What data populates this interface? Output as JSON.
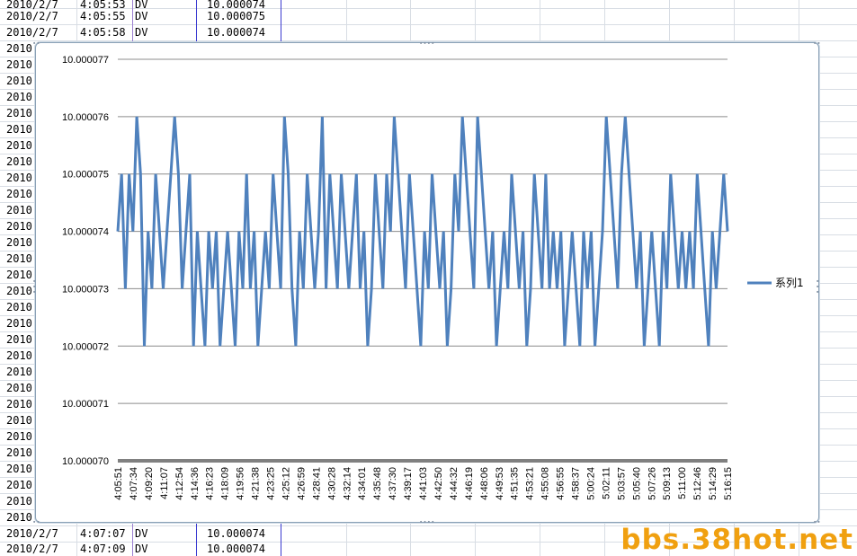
{
  "sheet": {
    "top_rows": [
      {
        "date": "2010/2/7",
        "time": "4:05:53",
        "type": "DV",
        "value": "10.000074"
      },
      {
        "date": "2010/2/7",
        "time": "4:05:55",
        "type": "DV",
        "value": "10.000075"
      },
      {
        "date": "2010/2/7",
        "time": "4:05:58",
        "type": "DV",
        "value": "10.000074"
      }
    ],
    "partial_row_label": "2010",
    "bottom_rows": [
      {
        "date": "2010/2/7",
        "time": "4:07:07",
        "type": "DV",
        "value": "10.000074"
      },
      {
        "date": "2010/2/7",
        "time": "4:07:09",
        "type": "DV",
        "value": "10.000074"
      }
    ]
  },
  "watermark": "bbs.38hot.net",
  "chart_data": {
    "type": "line",
    "title": "",
    "xlabel": "",
    "ylabel": "",
    "ylim": [
      10.00007,
      10.000077
    ],
    "yticks": [
      "10.000077",
      "10.000076",
      "10.000075",
      "10.000074",
      "10.000073",
      "10.000072",
      "10.000071",
      "10.000070"
    ],
    "categories": [
      "4:05:51",
      "4:07:34",
      "4:09:20",
      "4:11:07",
      "4:12:54",
      "4:14:36",
      "4:16:23",
      "4:18:09",
      "4:19:56",
      "4:21:38",
      "4:23:25",
      "4:25:12",
      "4:26:59",
      "4:28:41",
      "4:30:28",
      "4:32:14",
      "4:34:01",
      "4:35:48",
      "4:37:30",
      "4:39:17",
      "4:41:03",
      "4:42:50",
      "4:44:32",
      "4:46:19",
      "4:48:06",
      "4:49:53",
      "4:51:35",
      "4:53:21",
      "4:55:08",
      "4:56:55",
      "4:58:37",
      "5:00:24",
      "5:02:11",
      "5:03:57",
      "5:05:40",
      "5:07:26",
      "5:09:13",
      "5:11:00",
      "5:12:46",
      "5:14:29",
      "5:16:15"
    ],
    "grid": true,
    "legend": "right",
    "series": [
      {
        "name": "系列1",
        "color": "#4f81bd",
        "values": [
          10.000074,
          10.000075,
          10.000073,
          10.000075,
          10.000074,
          10.000076,
          10.000075,
          10.000072,
          10.000074,
          10.000073,
          10.000075,
          10.000074,
          10.000073,
          10.000074,
          10.000075,
          10.000076,
          10.000075,
          10.000073,
          10.000074,
          10.000075,
          10.000072,
          10.000074,
          10.000073,
          10.000072,
          10.000074,
          10.000073,
          10.000074,
          10.000072,
          10.000073,
          10.000074,
          10.000073,
          10.000072,
          10.000074,
          10.000073,
          10.000075,
          10.000073,
          10.000074,
          10.000072,
          10.000073,
          10.000074,
          10.000073,
          10.000075,
          10.000074,
          10.000073,
          10.000076,
          10.000075,
          10.000073,
          10.000072,
          10.000074,
          10.000073,
          10.000075,
          10.000074,
          10.000073,
          10.000074,
          10.000076,
          10.000073,
          10.000075,
          10.000074,
          10.000073,
          10.000075,
          10.000074,
          10.000073,
          10.000074,
          10.000075,
          10.000073,
          10.000074,
          10.000072,
          10.000073,
          10.000075,
          10.000074,
          10.000073,
          10.000075,
          10.000074,
          10.000076,
          10.000075,
          10.000074,
          10.000073,
          10.000075,
          10.000074,
          10.000073,
          10.000072,
          10.000074,
          10.000073,
          10.000075,
          10.000074,
          10.000073,
          10.000074,
          10.000072,
          10.000073,
          10.000075,
          10.000074,
          10.000076,
          10.000075,
          10.000074,
          10.000073,
          10.000076,
          10.000075,
          10.000074,
          10.000073,
          10.000074,
          10.000072,
          10.000073,
          10.000074,
          10.000073,
          10.000075,
          10.000074,
          10.000073,
          10.000074,
          10.000072,
          10.000073,
          10.000075,
          10.000074,
          10.000073,
          10.000075,
          10.000073,
          10.000074,
          10.000073,
          10.000074,
          10.000072,
          10.000073,
          10.000074,
          10.000073,
          10.000072,
          10.000074,
          10.000073,
          10.000074,
          10.000072,
          10.000073,
          10.000074,
          10.000076,
          10.000075,
          10.000074,
          10.000073,
          10.000075,
          10.000076,
          10.000075,
          10.000074,
          10.000073,
          10.000074,
          10.000072,
          10.000073,
          10.000074,
          10.000073,
          10.000072,
          10.000074,
          10.000073,
          10.000075,
          10.000074,
          10.000073,
          10.000074,
          10.000073,
          10.000074,
          10.000073,
          10.000075,
          10.000074,
          10.000073,
          10.000072,
          10.000074,
          10.000073,
          10.000074,
          10.000075,
          10.000074
        ]
      }
    ]
  }
}
